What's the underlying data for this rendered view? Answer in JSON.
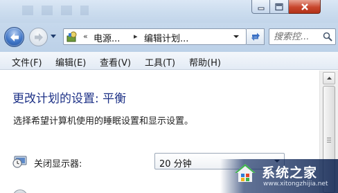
{
  "titlebar": {
    "buttons": {
      "minimize": "minimize-icon",
      "maximize": "maximize-icon",
      "close": "close-icon"
    }
  },
  "navbar": {
    "address": {
      "overflow": "«",
      "crumbs": [
        "电源...",
        "编辑计划..."
      ],
      "separator": "▸"
    },
    "search": {
      "placeholder": "搜索控..."
    }
  },
  "menu": [
    "文件(F)",
    "编辑(E)",
    "查看(V)",
    "工具(T)",
    "帮助(H)"
  ],
  "main": {
    "title": "更改计划的设置: 平衡",
    "description": "选择希望计算机使用的睡眠设置和显示设置。",
    "settings": [
      {
        "label": "关闭显示器:",
        "value": "20 分钟",
        "icon": "monitor-clock-icon"
      }
    ]
  },
  "watermark": {
    "name": "系统之家",
    "url": "www.xitongzhijia.net"
  },
  "colors": {
    "title": "#1e3287",
    "titlebar": "#cbdcee",
    "close": "#c8462d"
  }
}
